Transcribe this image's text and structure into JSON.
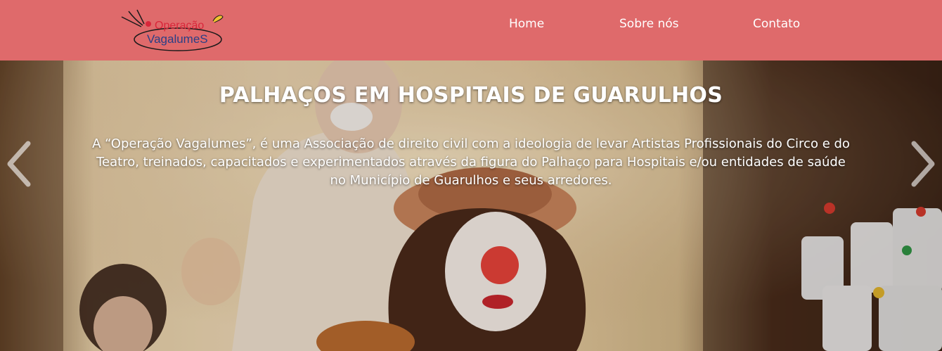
{
  "header": {
    "logo": {
      "line1": "Operação",
      "line2": "VagalumeS"
    },
    "nav": [
      {
        "label": "Home"
      },
      {
        "label": "Sobre nós"
      },
      {
        "label": "Contato"
      }
    ],
    "background_color": "#df6a6b"
  },
  "hero": {
    "title": "PALHAÇOS EM HOSPITAIS DE GUARULHOS",
    "text": "A “Operação Vagalumes”, é uma Associação de direito civil com a ideologia de levar Artistas Profissionais do Circo e do Teatro, treinados, capacitados e experimentados através da figura do Palhaço para Hospitais e/ou entidades de saúde no Município de Guarulhos e seus arredores.",
    "prev_icon": "chevron-left-icon",
    "next_icon": "chevron-right-icon"
  }
}
